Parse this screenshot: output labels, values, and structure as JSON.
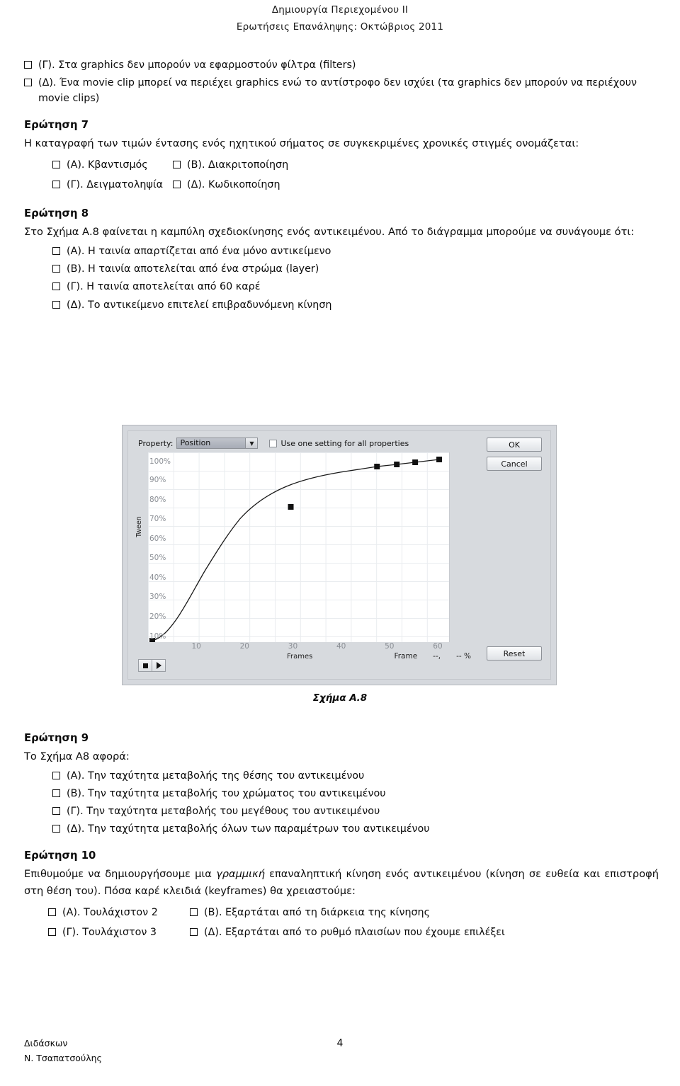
{
  "header": {
    "line1": "Δημιουργία Περιεχομένου ΙΙ",
    "line2": "Ερωτήσεις Επανάληψης: Οκτώβριος 2011"
  },
  "carryover_options": [
    {
      "label": "(Γ). Στα graphics δεν μπορούν να εφαρμοστούν φίλτρα (filters)"
    },
    {
      "label": "(Δ). Ένα movie clip μπορεί να περιέχει graphics ενώ το αντίστροφο δεν ισχύει (τα graphics δεν μπορούν να περιέχουν movie clips)"
    }
  ],
  "question7": {
    "title": "Ερώτηση 7",
    "stem": "Η καταγραφή των τιμών έντασης ενός ηχητικού σήματος σε συγκεκριμένες χρονικές στιγμές ονομάζεται:",
    "options": [
      {
        "label": "(Α). Κβαντισμός"
      },
      {
        "label": "(Β). Διακριτοποίηση"
      },
      {
        "label": "(Γ). Δειγματοληψία"
      },
      {
        "label": "(Δ). Κωδικοποίηση"
      }
    ]
  },
  "question8": {
    "title": "Ερώτηση 8",
    "stem": "Στο Σχήμα Α.8 φαίνεται η καμπύλη σχεδιοκίνησης ενός αντικειμένου. Από το διάγραμμα μπορούμε να συνάγουμε ότι:",
    "options": [
      {
        "label": "(Α). Η ταινία απαρτίζεται από ένα μόνο αντικείμενο"
      },
      {
        "label": "(Β). Η ταινία αποτελείται από ένα στρώμα (layer)"
      },
      {
        "label": "(Γ). Η ταινία αποτελείται από 60 καρέ"
      },
      {
        "label": "(Δ). Το αντικείμενο επιτελεί επιβραδυνόμενη κίνηση"
      }
    ]
  },
  "figure": {
    "caption": "Σχήμα Α.8",
    "dialog": {
      "property_label": "Property:",
      "property_value": "Position",
      "dropdown_arrow": "chevron-down-icon",
      "checkbox_label": "Use one setting for all properties",
      "checkbox_checked": false,
      "ok_label": "OK",
      "cancel_label": "Cancel",
      "reset_label": "Reset",
      "stop_icon": "stop-icon",
      "play_icon": "play-icon",
      "frame_readout_label": "Frame",
      "frame_readout_value": "--,",
      "percent_readout_value": "-- %"
    }
  },
  "chart_data": {
    "type": "line",
    "title": "",
    "xlabel": "Frames",
    "ylabel": "Tween",
    "xlim": [
      0,
      63
    ],
    "ylim": [
      0,
      105
    ],
    "grid": true,
    "legend": "none",
    "xticks": [
      10,
      20,
      30,
      40,
      50,
      60
    ],
    "xtick_labels": [
      "10",
      "20",
      "30",
      "40",
      "50",
      "60"
    ],
    "yticks": [
      10,
      20,
      30,
      40,
      50,
      60,
      70,
      80,
      90,
      100
    ],
    "ytick_labels": [
      "10%",
      "20%",
      "30%",
      "40%",
      "50%",
      "60%",
      "70%",
      "80%",
      "90%",
      "100%"
    ],
    "x": [
      0,
      3,
      6,
      10,
      14,
      18,
      22,
      26,
      30,
      34,
      38,
      42,
      47,
      52,
      56,
      61
    ],
    "y": [
      0,
      6,
      14,
      25,
      38,
      50,
      60,
      70,
      78,
      86,
      92,
      96,
      99,
      99.6,
      100,
      101
    ],
    "control_points": [
      {
        "frame": 0,
        "percent": 0
      },
      {
        "frame": 30,
        "percent": 78
      },
      {
        "frame": 47,
        "percent": 99
      },
      {
        "frame": 52,
        "percent": 99.6
      },
      {
        "frame": 56,
        "percent": 100
      },
      {
        "frame": 61,
        "percent": 101
      }
    ],
    "series": [
      {
        "name": "Position easing curve",
        "x": [
          0,
          3,
          6,
          10,
          14,
          18,
          22,
          26,
          30,
          34,
          38,
          42,
          47,
          52,
          56,
          61
        ],
        "values": [
          0,
          6,
          14,
          25,
          38,
          50,
          60,
          70,
          78,
          86,
          92,
          96,
          99,
          99.6,
          100,
          101
        ]
      }
    ]
  },
  "question9": {
    "title": "Ερώτηση 9",
    "stem": "Το Σχήμα Α8 αφορά:",
    "options": [
      {
        "label": "(Α). Την ταχύτητα μεταβολής της θέσης του αντικειμένου"
      },
      {
        "label": "(Β). Την ταχύτητα μεταβολής του χρώματος του αντικειμένου"
      },
      {
        "label": "(Γ). Την ταχύτητα μεταβολής του μεγέθους του αντικειμένου"
      },
      {
        "label": "(Δ). Την ταχύτητα μεταβολής όλων των παραμέτρων του αντικειμένου"
      }
    ]
  },
  "question10": {
    "title": "Ερώτηση 10",
    "stem_part1": "Επιθυμούμε να δημιουργήσουμε μια ",
    "stem_italic": "γραμμική",
    "stem_part2": " επαναληπτική κίνηση ενός αντικειμένου (κίνηση σε ευθεία και επιστροφή στη θέση του). Πόσα καρέ κλειδιά (keyframes) θα χρειαστούμε:",
    "options": [
      {
        "label": "(Α). Τουλάχιστον 2"
      },
      {
        "label": "(Β). Εξαρτάται από τη διάρκεια της κίνησης"
      },
      {
        "label": "(Γ).  Τουλάχιστον 3"
      },
      {
        "label": "(Δ). Εξαρτάται από το ρυθμό πλαισίων που έχουμε επιλέξει"
      }
    ]
  },
  "footer": {
    "left_line1": "Διδάσκων",
    "left_line2": "Ν. Τσαπατσούλης",
    "page_number": "4"
  }
}
